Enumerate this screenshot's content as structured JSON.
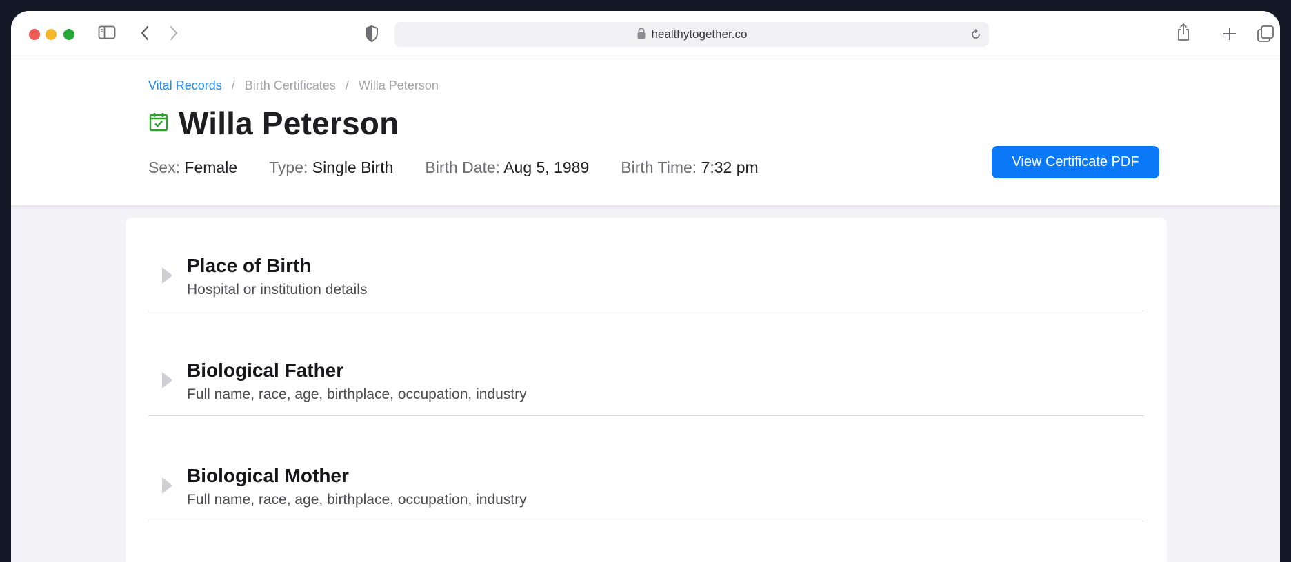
{
  "browser": {
    "url": "healthytogether.co"
  },
  "breadcrumb": [
    {
      "label": "Vital Records"
    },
    {
      "separator": "/"
    },
    {
      "label": "Birth Certificates"
    },
    {
      "label": "Willa Peterson"
    }
  ],
  "record": {
    "name": "Willa Peterson",
    "status_icon": "calendar-check-icon",
    "sex_label": "Sex:",
    "sex": "Female",
    "type_label": "Type:",
    "type": "Single Birth",
    "birth_date_label": "Birth Date:",
    "birth_date": "Aug 5, 1989",
    "birth_time_label": "Birth Time:",
    "birth_time": "7:32 pm"
  },
  "actions": {
    "view_pdf": "View Certificate PDF"
  },
  "sections": [
    {
      "title": "Place of Birth",
      "subtitle": "Hospital or institution details"
    },
    {
      "title": "Biological Father",
      "subtitle": "Full name, race, age, birthplace, occupation, industry"
    },
    {
      "title": "Biological Mother",
      "subtitle": "Full name, race, age, birthplace, occupation, industry"
    }
  ],
  "colors": {
    "accent": "#0b78f7",
    "link": "#1f8aef",
    "status_green": "#2aa32a",
    "background": "#f4f3f8"
  }
}
